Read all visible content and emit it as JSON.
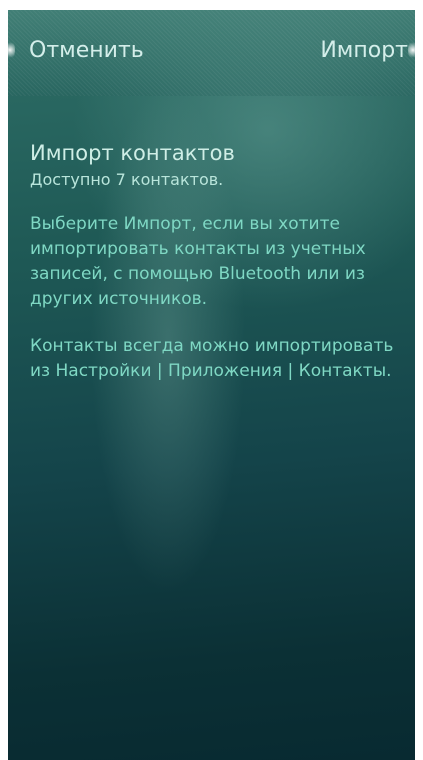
{
  "header": {
    "cancel_label": "Отменить",
    "import_label": "Импорт"
  },
  "main": {
    "title": "Импорт контактов",
    "subtitle": "Доступно 7 контактов.",
    "paragraph1": "Выберите Импорт, если вы хотите импортировать контакты из учетных записей, с помощью Bluetooth или из других источников.",
    "paragraph2": "Контакты всегда можно импортировать из Настройки | Приложения | Контакты."
  },
  "colors": {
    "background_top": "#2f6f67",
    "background_bottom": "#082a31",
    "header_text": "#d4eeea",
    "body_text": "#7fd8c4"
  }
}
